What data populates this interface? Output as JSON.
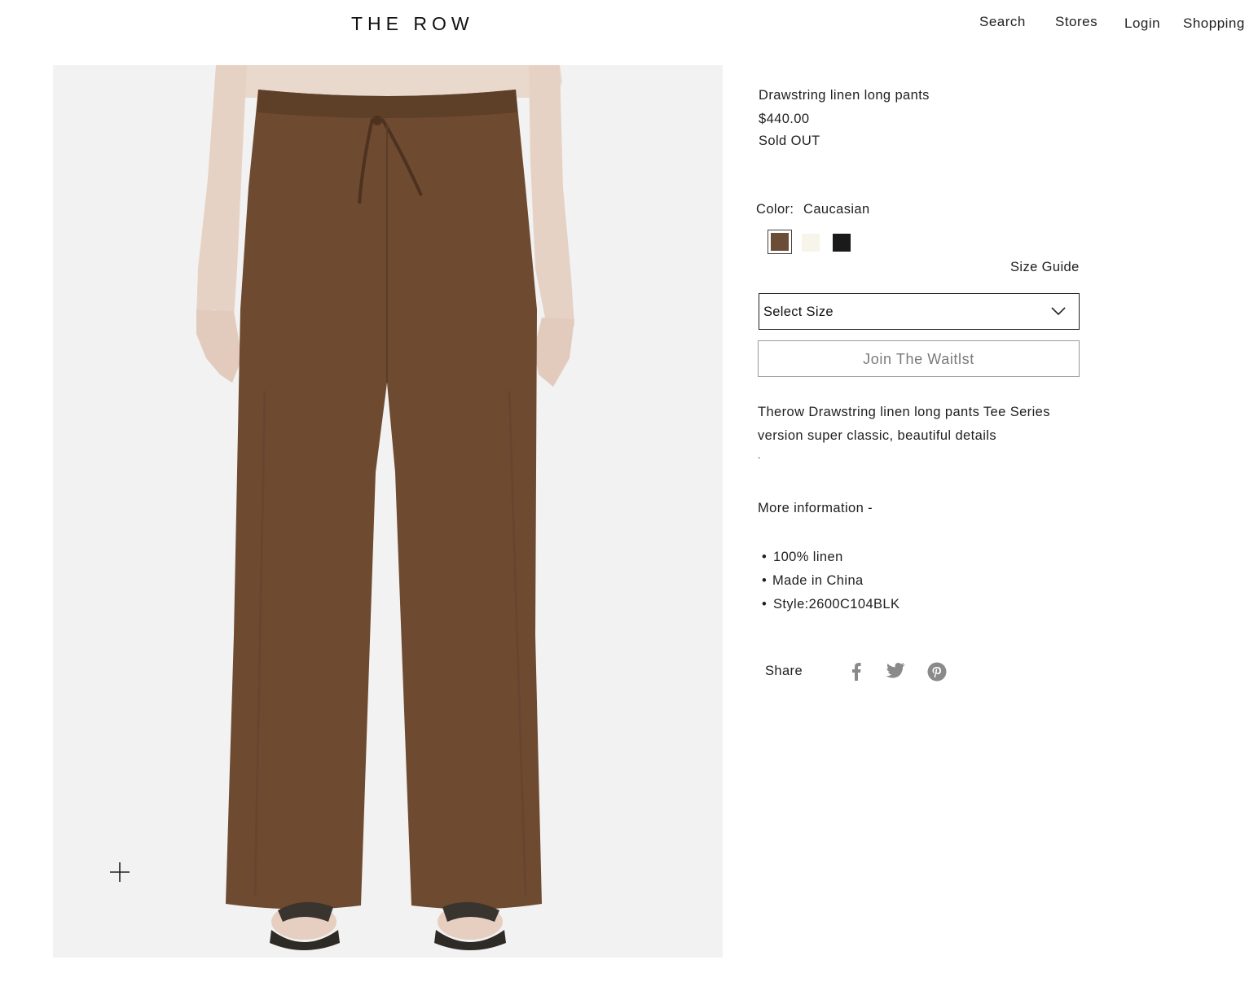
{
  "header": {
    "logo": "THE ROW",
    "nav": [
      "Search",
      "Stores",
      "Login",
      "Shopping"
    ]
  },
  "product": {
    "title": "Drawstring linen long pants",
    "price": "$440.00",
    "availability": "Sold OUT",
    "color_label": "Color:",
    "color_value": "Caucasian",
    "swatches": [
      {
        "name": "brown",
        "color": "#6b4c36",
        "selected": true
      },
      {
        "name": "cream",
        "color": "#f7f5ea",
        "selected": false
      },
      {
        "name": "black",
        "color": "#1a1a1a",
        "selected": false
      }
    ],
    "size_guide": "Size Guide",
    "size_select_placeholder": "Select Size",
    "waitlist_button": "Join  The Waitlst",
    "description_line1": "Therow Drawstring linen long pants  Tee Series",
    "description_line2": "version super classic, beautiful details",
    "description_line3": ".",
    "more_info": "More information -",
    "details": [
      "100% linen",
      "Made in China",
      "Style:2600C104BLK"
    ],
    "share_label": "Share",
    "share_icons": [
      "facebook-icon",
      "twitter-icon",
      "pinterest-icon"
    ]
  },
  "colors": {
    "pants": "#6e4a30",
    "background": "#f2f2f2",
    "text": "#1f1f1f"
  }
}
